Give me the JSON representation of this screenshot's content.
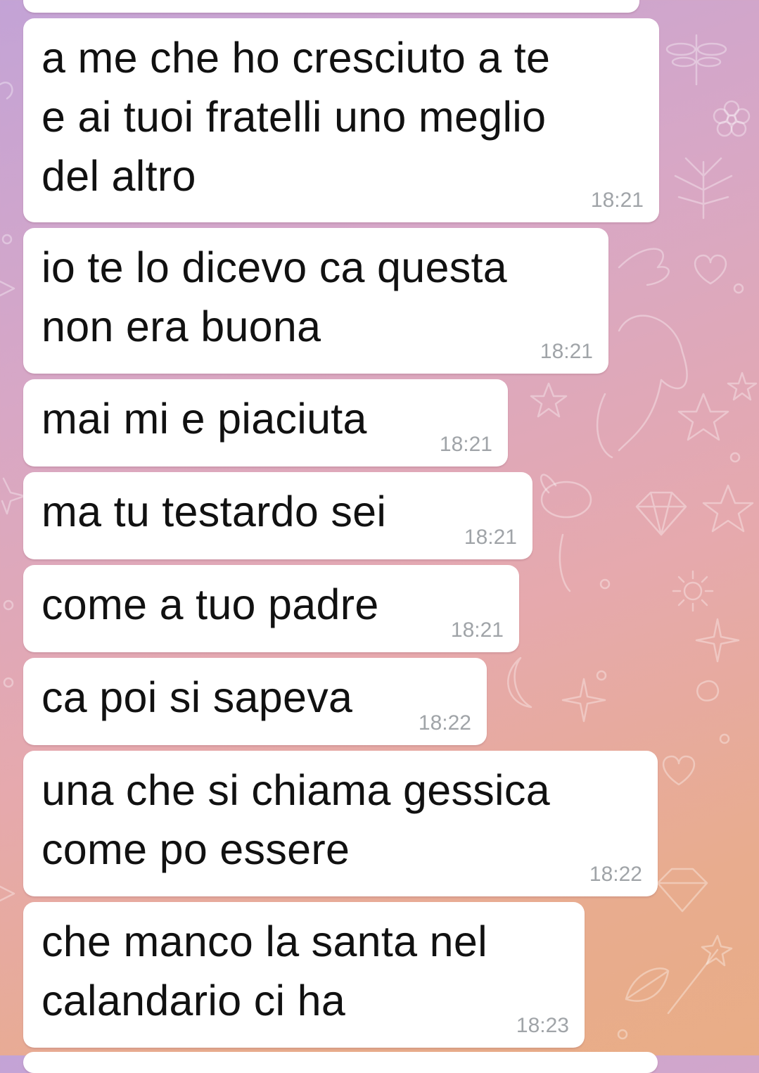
{
  "chat": {
    "messages": [
      {
        "text": "a me che ho cresciuto a te\ne ai tuoi fratelli uno meglio\ndel altro",
        "time": "18:21"
      },
      {
        "text": "io te lo dicevo ca questa\nnon era buona",
        "time": "18:21"
      },
      {
        "text": "mai mi e piaciuta",
        "time": "18:21"
      },
      {
        "text": "ma tu testardo sei",
        "time": "18:21"
      },
      {
        "text": "come a tuo padre",
        "time": "18:21"
      },
      {
        "text": "ca poi si sapeva",
        "time": "18:22"
      },
      {
        "text": "una che si chiama gessica\ncome po essere",
        "time": "18:22"
      },
      {
        "text": "che manco la santa nel\ncalandario ci ha",
        "time": "18:23"
      }
    ]
  },
  "colors": {
    "bubble": "#ffffff",
    "text": "#111111",
    "timestamp": "#a0a4a8",
    "wallpaper_top": "#c3a3d6",
    "wallpaper_bottom": "#e9ad86"
  },
  "icons": [
    "dragonfly-icon",
    "flower-icon",
    "leaf-icon",
    "heart-icon",
    "star-icon",
    "unicorn-icon",
    "diamond-icon",
    "sun-icon",
    "moon-icon",
    "bunny-icon",
    "magic-wand-icon"
  ]
}
